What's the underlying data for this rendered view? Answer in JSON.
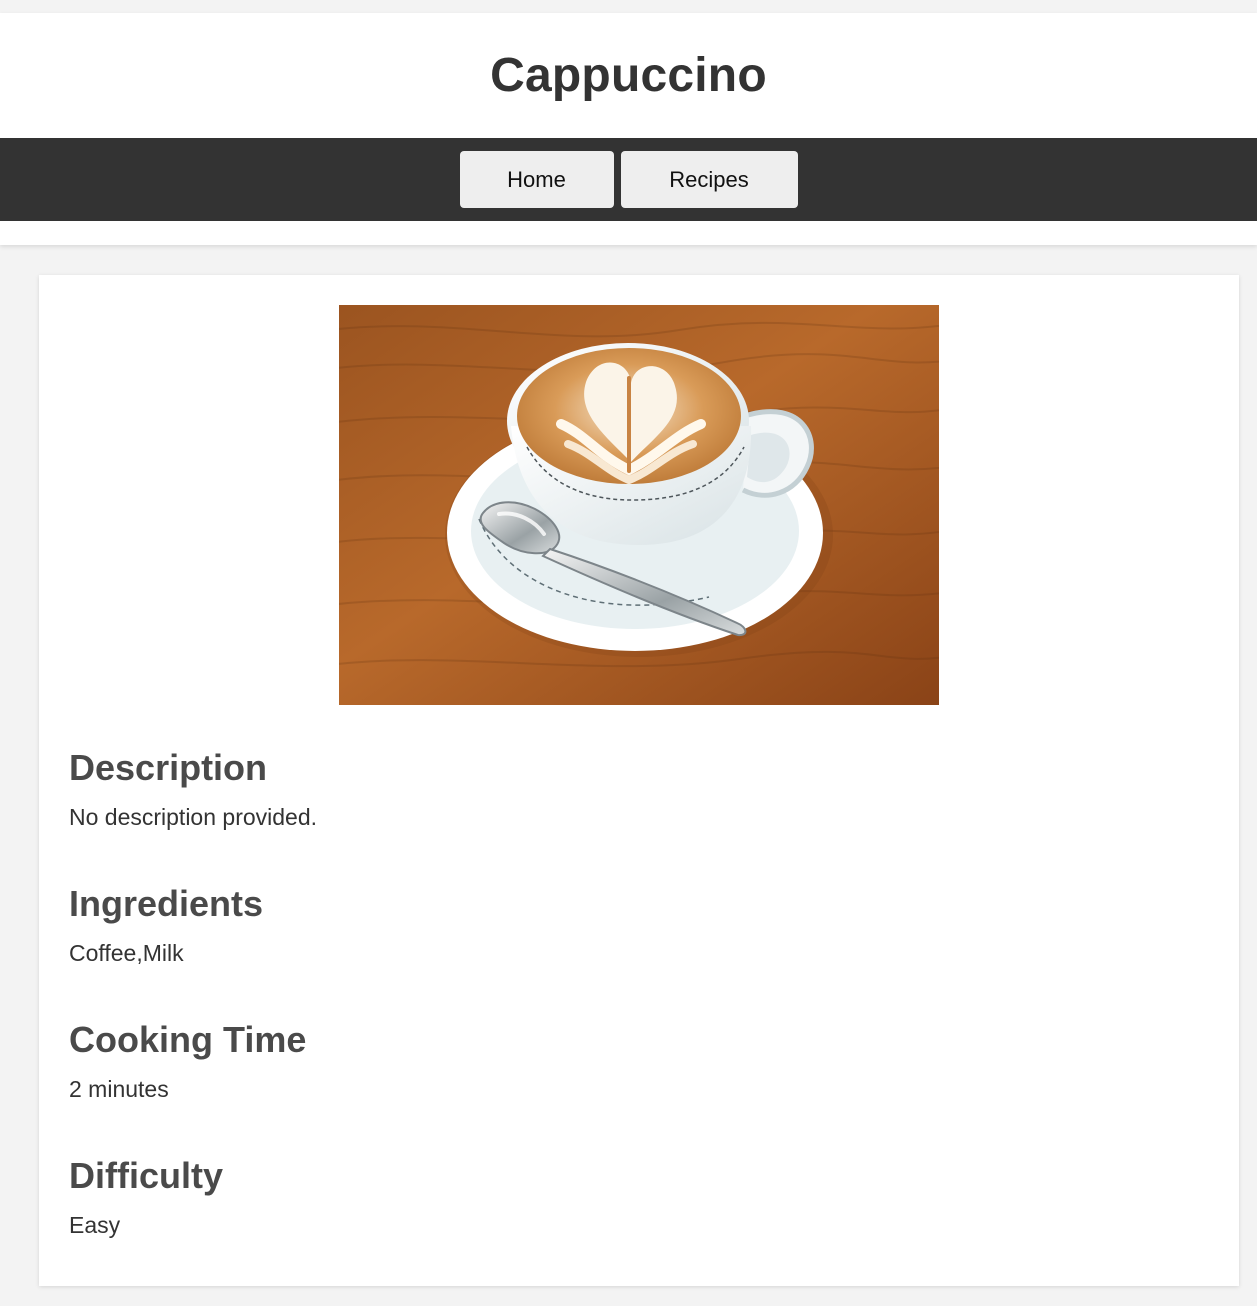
{
  "page": {
    "title": "Cappuccino"
  },
  "nav": {
    "items": [
      {
        "label": "Home"
      },
      {
        "label": "Recipes"
      }
    ]
  },
  "recipe": {
    "image_alt": "Cappuccino with heart latte art",
    "sections": [
      {
        "heading": "Description",
        "text": "No description provided."
      },
      {
        "heading": "Ingredients",
        "text": "Coffee,Milk"
      },
      {
        "heading": "Cooking Time",
        "text": "2 minutes"
      },
      {
        "heading": "Difficulty",
        "text": "Easy"
      }
    ]
  },
  "colors": {
    "background": "#f3f3f3",
    "header_background": "#ffffff",
    "nav_background": "#333333",
    "button_background": "#eeeeee",
    "heading_text": "#4a4a4a",
    "body_text": "#333333"
  }
}
